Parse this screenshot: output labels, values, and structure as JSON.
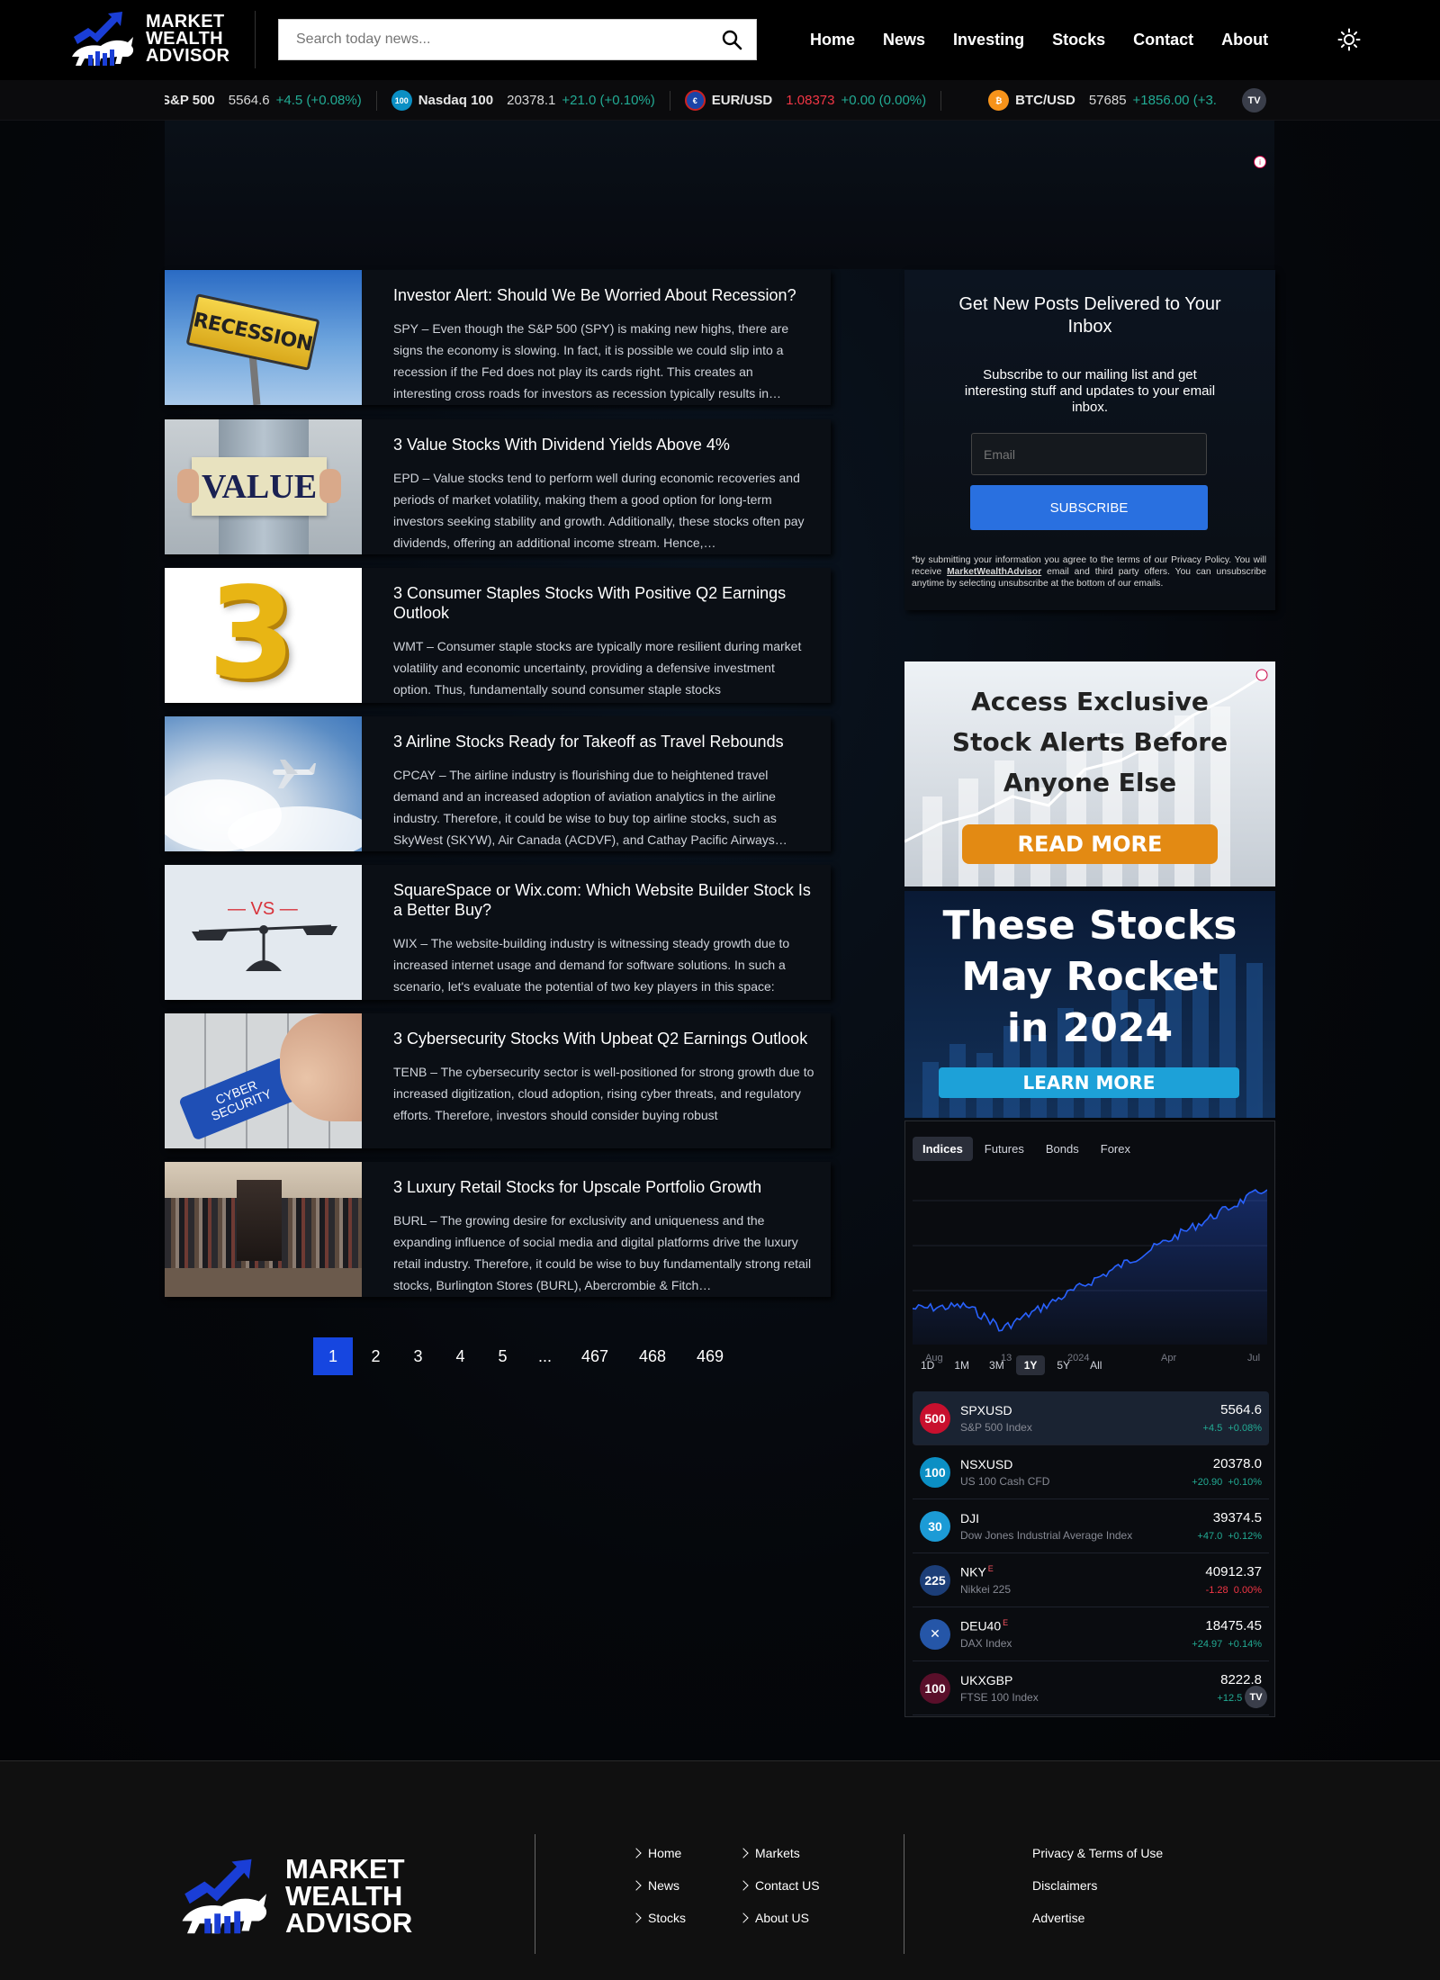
{
  "brand": {
    "name_line1": "MARKET",
    "name_line2": "WEALTH",
    "name_line3": "ADVISOR"
  },
  "search": {
    "placeholder": "Search today news..."
  },
  "nav": [
    "Home",
    "News",
    "Investing",
    "Stocks",
    "Contact",
    "About"
  ],
  "ticker": [
    {
      "symbol": "S&P 500",
      "price": "5564.6",
      "change": "+4.5 (+0.08%)",
      "dir": "up"
    },
    {
      "symbol": "Nasdaq 100",
      "price": "20378.1",
      "change": "+21.0 (+0.10%)",
      "dir": "up",
      "badge": "100"
    },
    {
      "symbol": "EUR/USD",
      "price": "1.08373",
      "change": "+0.00 (0.00%)",
      "dir": "up",
      "price_dir": "dn"
    },
    {
      "symbol": "BTC/USD",
      "price": "57685",
      "change": "+1856.00 (+3.",
      "dir": "up"
    }
  ],
  "posts": [
    {
      "title": "Investor Alert: Should We Be Worried About Recession?",
      "excerpt": "SPY – Even though the S&P 500 (SPY) is making new highs, there are signs the economy is slowing. In fact, it is possible we could slip into a recession if the Fed does not play its cards right. This creates an interesting cross roads for investors as recession typically results in…",
      "thumb_text": "RECESSION"
    },
    {
      "title": "3 Value Stocks With Dividend Yields Above 4%",
      "excerpt": "EPD – Value stocks tend to perform well during economic recoveries and periods of market volatility, making them a good option for long-term investors seeking stability and growth. Additionally, these stocks often pay dividends, offering an additional income stream. Hence,…",
      "thumb_text": "VALUE"
    },
    {
      "title": "3 Consumer Staples Stocks With Positive Q2 Earnings Outlook",
      "excerpt": "WMT – Consumer staple stocks are typically more resilient during market volatility and economic uncertainty, providing a defensive investment option. Thus, fundamentally sound consumer staple stocks",
      "thumb_text": "3"
    },
    {
      "title": "3 Airline Stocks Ready for Takeoff as Travel Rebounds",
      "excerpt": "CPCAY – The airline industry is flourishing due to heightened travel demand and an increased adoption of aviation analytics in the airline industry. Therefore, it could be wise to buy top airline stocks, such as SkyWest (SKYW), Air Canada (ACDVF), and Cathay Pacific Airways…"
    },
    {
      "title": "SquareSpace or Wix.com: Which Website Builder Stock Is a Better Buy?",
      "excerpt": "WIX – The website-building industry is witnessing steady growth due to increased internet usage and demand for software solutions. In such a scenario, let's evaluate the potential of two key players in this space:",
      "thumb_text": "— VS —"
    },
    {
      "title": "3 Cybersecurity Stocks With Upbeat Q2 Earnings Outlook",
      "excerpt": "TENB – The cybersecurity sector is well-positioned for strong growth due to increased digitization, cloud adoption, rising cyber threats, and regulatory efforts. Therefore, investors should consider buying robust",
      "thumb_text": "CYBER SECURITY"
    },
    {
      "title": "3 Luxury Retail Stocks for Upscale Portfolio Growth",
      "excerpt": "BURL – The growing desire for exclusivity and uniqueness and the expanding influence of social media and digital platforms drive the luxury retail industry. Therefore, it could be wise to buy fundamentally strong retail stocks, Burlington Stores (BURL), Abercrombie & Fitch…"
    }
  ],
  "pagination": [
    "1",
    "2",
    "3",
    "4",
    "5",
    "...",
    "467",
    "468",
    "469"
  ],
  "subscribe": {
    "title": "Get New Posts Delivered to Your Inbox",
    "desc": "Subscribe to our mailing list and get interesting stuff and updates to your email inbox.",
    "email_placeholder": "Email",
    "button": "SUBSCRIBE",
    "legal_pre": "*by submitting your information you agree to the terms of our Privacy Policy. You will receive ",
    "legal_brand": "MarketWealthAdvisor",
    "legal_post": " email and third party offers. You can unsubscribe anytime by selecting unsubscribe at the bottom of our emails."
  },
  "promo1": {
    "line1": "Access Exclusive",
    "line2": "Stock Alerts Before",
    "line3": "Anyone Else",
    "button": "READ MORE"
  },
  "promo2": {
    "line1": "These Stocks",
    "line2": "May Rocket",
    "line3": "in 2024",
    "button": "LEARN MORE"
  },
  "market_widget": {
    "tabs": [
      "Indices",
      "Futures",
      "Bonds",
      "Forex"
    ],
    "active_tab": "Indices",
    "x_labels": [
      "Aug",
      "13",
      "2024",
      "Apr",
      "Jul"
    ],
    "ranges": [
      "1D",
      "1M",
      "3M",
      "1Y",
      "5Y",
      "All"
    ],
    "active_range": "1Y",
    "rows": [
      {
        "badge": "500",
        "symbol": "SPXUSD",
        "name": "S&P 500 Index",
        "price": "5564.6",
        "chg": "+4.5",
        "pct": "+0.08%",
        "dir": "up",
        "color": "#c8102e",
        "selected": true
      },
      {
        "badge": "100",
        "symbol": "NSXUSD",
        "name": "US 100 Cash CFD",
        "price": "20378.0",
        "chg": "+20.90",
        "pct": "+0.10%",
        "dir": "up",
        "color": "#0b8fc4"
      },
      {
        "badge": "30",
        "symbol": "DJI",
        "name": "Dow Jones Industrial Average Index",
        "price": "39374.5",
        "chg": "+47.0",
        "pct": "+0.12%",
        "dir": "up",
        "color": "#1c9bd6"
      },
      {
        "badge": "225",
        "symbol": "NKY",
        "sup": "E",
        "name": "Nikkei 225",
        "price": "40912.37",
        "chg": "-1.28",
        "pct": "0.00%",
        "dir": "dn",
        "color": "#1c3e78"
      },
      {
        "badge": "✕",
        "symbol": "DEU40",
        "sup": "E",
        "name": "DAX Index",
        "price": "18475.45",
        "chg": "+24.97",
        "pct": "+0.14%",
        "dir": "up",
        "color": "#2556a8"
      },
      {
        "badge": "100",
        "symbol": "UKXGBP",
        "name": "FTSE 100 Index",
        "price": "8222.8",
        "chg": "+12.5",
        "pct": "+0.",
        "dir": "up",
        "color": "#5a0f2a"
      }
    ]
  },
  "footer": {
    "col1": [
      "Home",
      "News",
      "Stocks"
    ],
    "col2": [
      "Markets",
      "Contact US",
      "About US"
    ],
    "col3": [
      "Privacy & Terms of Use",
      "Disclaimers",
      "Advertise"
    ]
  },
  "colors": {
    "accent": "#1646e0",
    "subscribe_btn": "#2970e0",
    "up": "#22ab94",
    "down": "#f23645"
  }
}
